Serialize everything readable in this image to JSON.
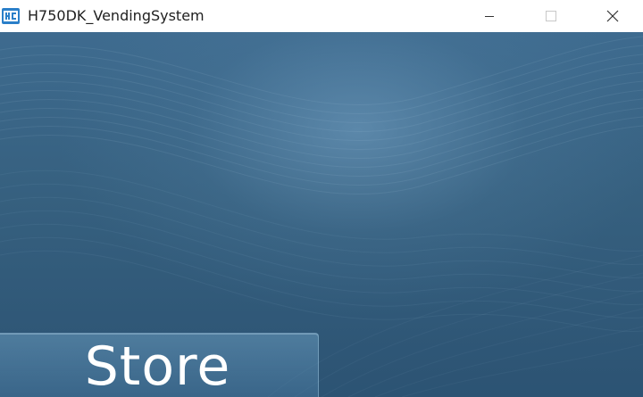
{
  "window": {
    "title": "H750DK_VendingSystem",
    "icon": "app-icon",
    "controls": {
      "minimize_icon": "minimize-icon",
      "maximize_icon": "maximize-icon",
      "close_icon": "close-icon"
    }
  },
  "main": {
    "store_button_label": "Store"
  },
  "colors": {
    "background": "#36607f",
    "titlebar": "#ffffff",
    "accent": "#2a7fc9"
  }
}
